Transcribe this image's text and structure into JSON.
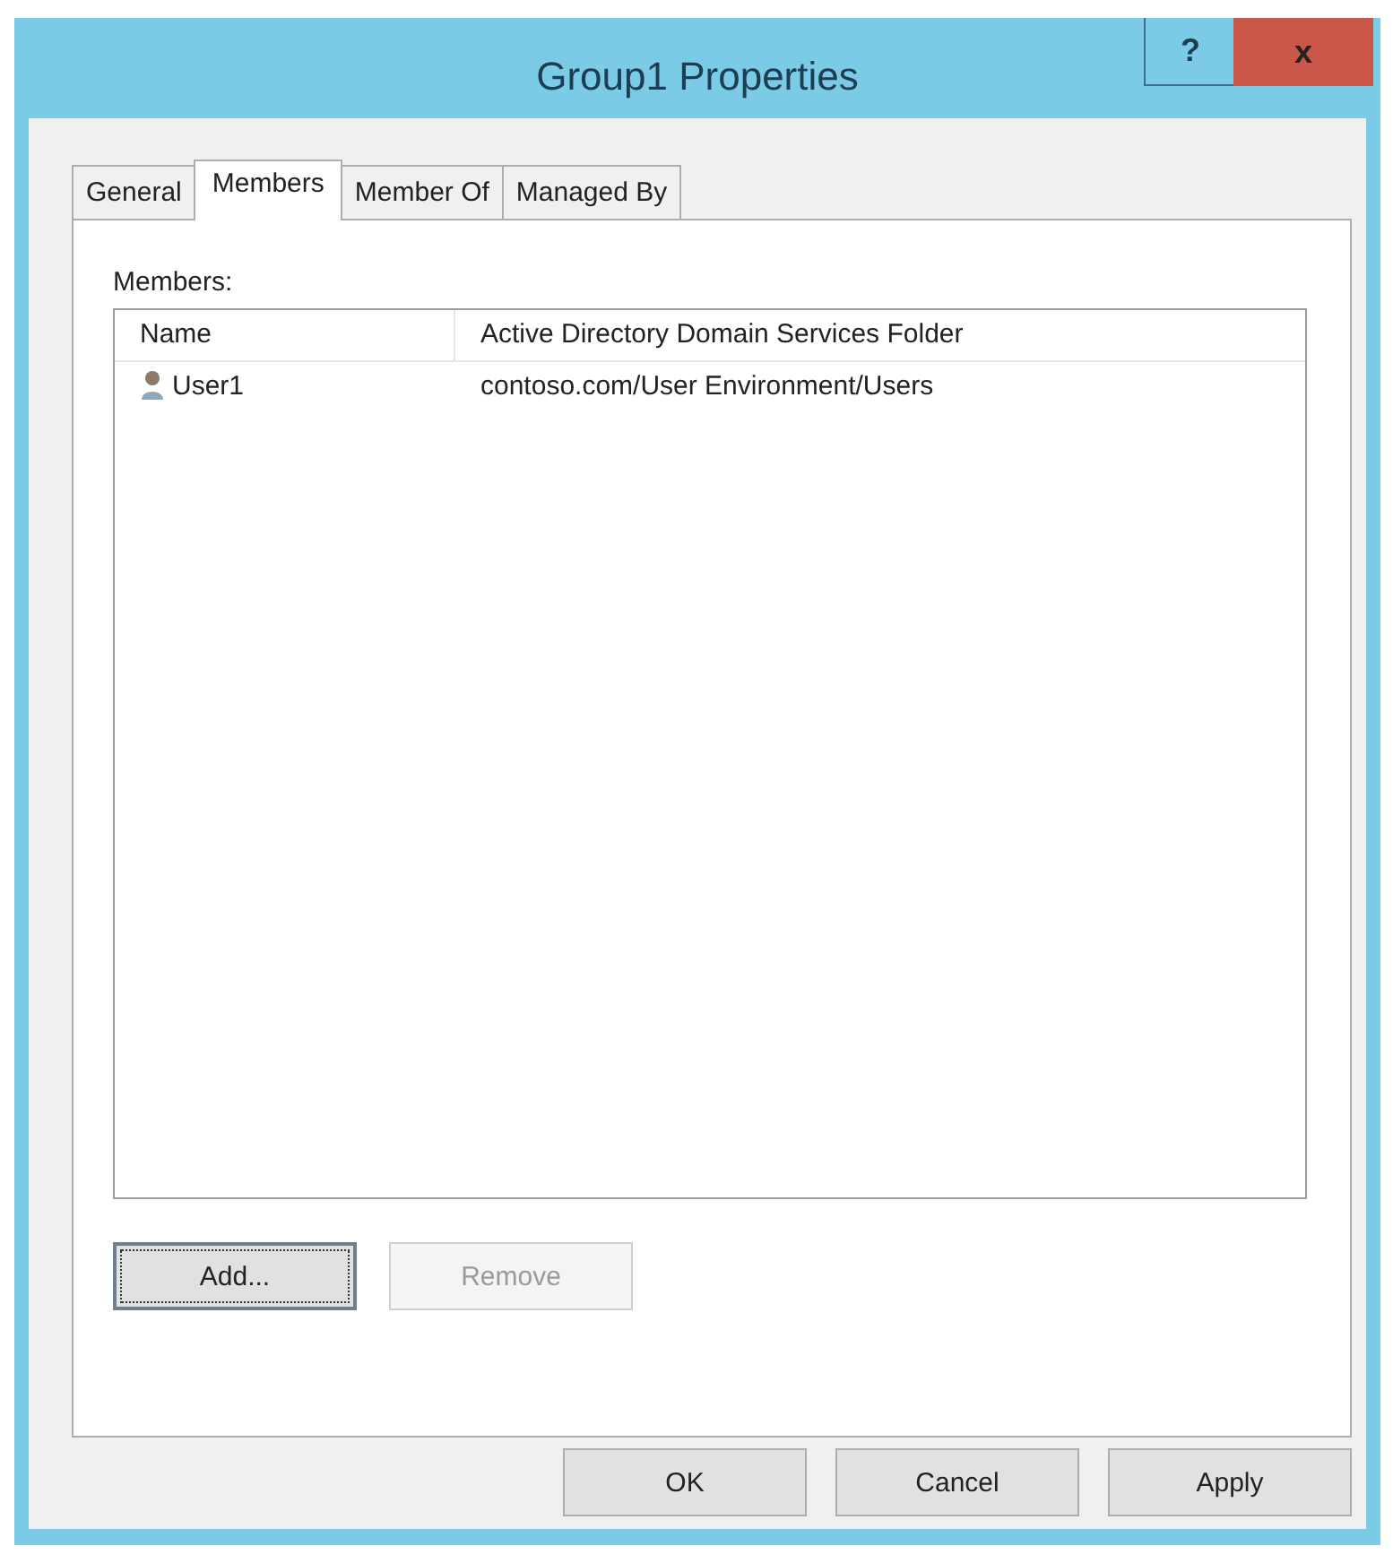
{
  "window": {
    "title": "Group1 Properties",
    "help": "?",
    "close": "x"
  },
  "tabs": [
    {
      "label": "General",
      "selected": false
    },
    {
      "label": "Members",
      "selected": true
    },
    {
      "label": "Member Of",
      "selected": false
    },
    {
      "label": "Managed By",
      "selected": false
    }
  ],
  "members_label": "Members:",
  "table": {
    "columns": [
      "Name",
      "Active Directory Domain Services Folder"
    ],
    "rows": [
      {
        "name": "User1",
        "folder": "contoso.com/User Environment/Users"
      }
    ]
  },
  "list_buttons": [
    {
      "label": "Add...",
      "disabled": false,
      "focused": true
    },
    {
      "label": "Remove",
      "disabled": true,
      "focused": false
    }
  ],
  "dialog_buttons": [
    {
      "label": "OK",
      "disabled": false
    },
    {
      "label": "Cancel",
      "disabled": false
    },
    {
      "label": "Apply",
      "disabled": false
    }
  ]
}
